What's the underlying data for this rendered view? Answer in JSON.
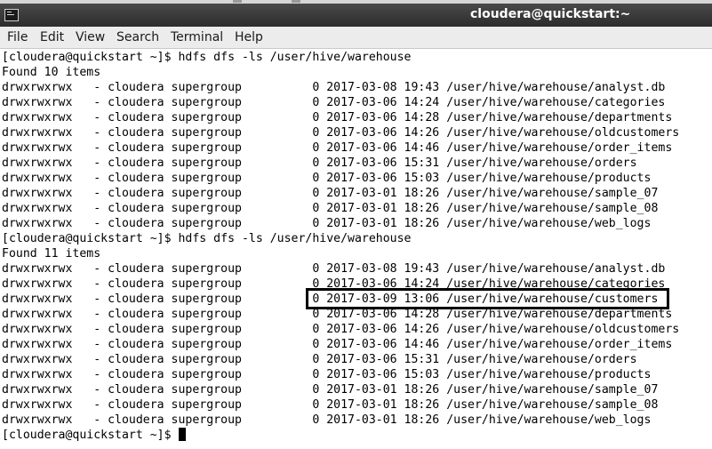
{
  "window": {
    "title": "cloudera@quickstart:~"
  },
  "icons": {
    "app": "terminal-icon",
    "cursor": "block-cursor"
  },
  "menu": [
    "File",
    "Edit",
    "View",
    "Search",
    "Terminal",
    "Help"
  ],
  "terminal": {
    "prompt": "[cloudera@quickstart ~]$ ",
    "lines": [
      "[cloudera@quickstart ~]$ hdfs dfs -ls /user/hive/warehouse",
      "Found 10 items",
      "drwxrwxrwx   - cloudera supergroup          0 2017-03-08 19:43 /user/hive/warehouse/analyst.db",
      "drwxrwxrwx   - cloudera supergroup          0 2017-03-06 14:24 /user/hive/warehouse/categories",
      "drwxrwxrwx   - cloudera supergroup          0 2017-03-06 14:28 /user/hive/warehouse/departments",
      "drwxrwxrwx   - cloudera supergroup          0 2017-03-06 14:26 /user/hive/warehouse/oldcustomers",
      "drwxrwxrwx   - cloudera supergroup          0 2017-03-06 14:46 /user/hive/warehouse/order_items",
      "drwxrwxrwx   - cloudera supergroup          0 2017-03-06 15:31 /user/hive/warehouse/orders",
      "drwxrwxrwx   - cloudera supergroup          0 2017-03-06 15:03 /user/hive/warehouse/products",
      "drwxrwxrwx   - cloudera supergroup          0 2017-03-01 18:26 /user/hive/warehouse/sample_07",
      "drwxrwxrwx   - cloudera supergroup          0 2017-03-01 18:26 /user/hive/warehouse/sample_08",
      "drwxrwxrwx   - cloudera supergroup          0 2017-03-01 18:26 /user/hive/warehouse/web_logs",
      "[cloudera@quickstart ~]$ hdfs dfs -ls /user/hive/warehouse",
      "Found 11 items",
      "drwxrwxrwx   - cloudera supergroup          0 2017-03-08 19:43 /user/hive/warehouse/analyst.db",
      "drwxrwxrwx   - cloudera supergroup          0 2017-03-06 14:24 /user/hive/warehouse/categories",
      "drwxrwxrwx   - cloudera supergroup          0 2017-03-09 13:06 /user/hive/warehouse/customers",
      "drwxrwxrwx   - cloudera supergroup          0 2017-03-06 14:28 /user/hive/warehouse/departments",
      "drwxrwxrwx   - cloudera supergroup          0 2017-03-06 14:26 /user/hive/warehouse/oldcustomers",
      "drwxrwxrwx   - cloudera supergroup          0 2017-03-06 14:46 /user/hive/warehouse/order_items",
      "drwxrwxrwx   - cloudera supergroup          0 2017-03-06 15:31 /user/hive/warehouse/orders",
      "drwxrwxrwx   - cloudera supergroup          0 2017-03-06 15:03 /user/hive/warehouse/products",
      "drwxrwxrwx   - cloudera supergroup          0 2017-03-01 18:26 /user/hive/warehouse/sample_07",
      "drwxrwxrwx   - cloudera supergroup          0 2017-03-01 18:26 /user/hive/warehouse/sample_08",
      "drwxrwxrwx   - cloudera supergroup          0 2017-03-01 18:26 /user/hive/warehouse/web_logs"
    ]
  }
}
